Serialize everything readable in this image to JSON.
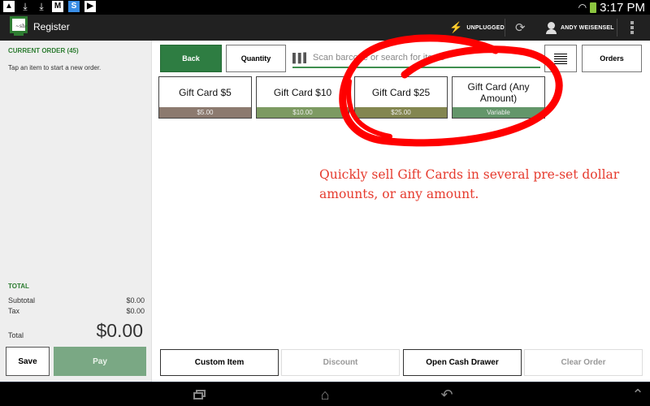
{
  "status_bar": {
    "left_icons": [
      "gallery-icon",
      "download-icon",
      "download-icon",
      "gmail-icon",
      "skype-icon",
      "play-store-icon"
    ],
    "time": "3:17 PM",
    "battery_color": "#8bc53f"
  },
  "header": {
    "app_title": "Register",
    "connection_status": "UNPLUGGED",
    "user_name": "ANDY WEISENSEL"
  },
  "order_panel": {
    "heading": "CURRENT ORDER (45)",
    "empty_message": "Tap an item to start a new order.",
    "total_heading": "TOTAL",
    "subtotal_label": "Subtotal",
    "subtotal_value": "$0.00",
    "tax_label": "Tax",
    "tax_value": "$0.00",
    "total_label": "Total",
    "total_value": "$0.00",
    "save_label": "Save",
    "pay_label": "Pay"
  },
  "toolbar": {
    "back_label": "Back",
    "quantity_label": "Quantity",
    "search_placeholder": "Scan barcode or search for items",
    "orders_label": "Orders"
  },
  "items": [
    {
      "name": "Gift Card $5",
      "price": "$5.00",
      "color": "#8c7a6f"
    },
    {
      "name": "Gift Card $10",
      "price": "$10.00",
      "color": "#7d9a62"
    },
    {
      "name": "Gift Card $25",
      "price": "$25.00",
      "color": "#838650"
    },
    {
      "name": "Gift Card (Any Amount)",
      "price": "Variable",
      "color": "#63966a"
    }
  ],
  "annotation": {
    "text": "Quickly sell Gift Cards in several pre-set dollar amounts, or any amount.",
    "color": "#e63b2e"
  },
  "bottom_actions": [
    {
      "label": "Custom Item",
      "enabled": true
    },
    {
      "label": "Discount",
      "enabled": false
    },
    {
      "label": "Open Cash Drawer",
      "enabled": true
    },
    {
      "label": "Clear Order",
      "enabled": false
    }
  ],
  "theme": {
    "brand_green": "#2e7d42",
    "pay_green": "#7aa884",
    "heading_green": "#2e7d32"
  }
}
